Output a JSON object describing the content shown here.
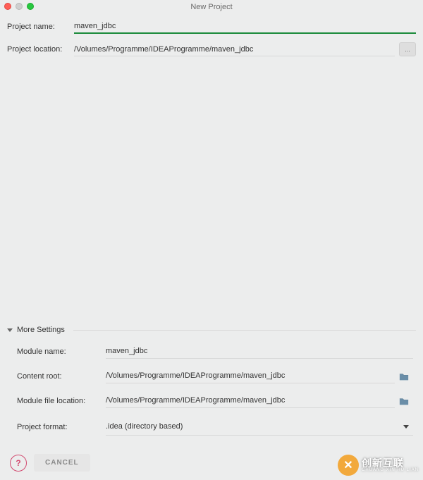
{
  "window": {
    "title": "New Project"
  },
  "form": {
    "projectName": {
      "label": "Project name:",
      "value": "maven_jdbc"
    },
    "projectLocation": {
      "label": "Project location:",
      "value": "/Volumes/Programme/IDEAProgramme/maven_jdbc"
    }
  },
  "moreSettings": {
    "header": "More Settings",
    "moduleName": {
      "label": "Module name:",
      "value": "maven_jdbc"
    },
    "contentRoot": {
      "label": "Content root:",
      "value": "/Volumes/Programme/IDEAProgramme/maven_jdbc"
    },
    "moduleFileLocation": {
      "label": "Module file location:",
      "value": "/Volumes/Programme/IDEAProgramme/maven_jdbc"
    },
    "projectFormat": {
      "label": "Project format:",
      "value": ".idea (directory based)"
    }
  },
  "buttons": {
    "cancel": "CANCEL",
    "help": "?",
    "browse": "..."
  },
  "watermark": {
    "brand": "创新互联",
    "sub": "CHUANG XIN HU LIAN"
  }
}
